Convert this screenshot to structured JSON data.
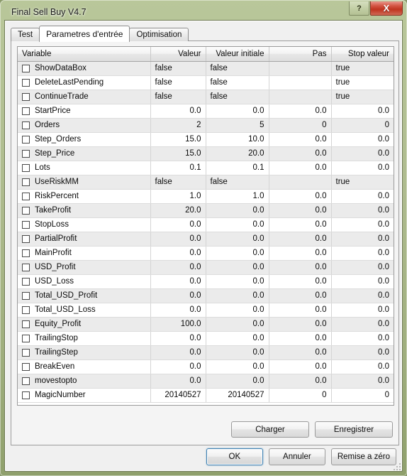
{
  "window": {
    "title": "Final Sell Buy V4.7",
    "help_label": "?",
    "close_label": "X",
    "frame_color": "#aebb8e",
    "close_color": "#c6402c"
  },
  "tabs": [
    {
      "label": "Test",
      "active": false
    },
    {
      "label": "Parametres d'entrée",
      "active": true
    },
    {
      "label": "Optimisation",
      "active": false
    }
  ],
  "table": {
    "columns": [
      {
        "key": "variable",
        "label": "Variable",
        "align": "left"
      },
      {
        "key": "value",
        "label": "Valeur",
        "align": "right"
      },
      {
        "key": "initial",
        "label": "Valeur initiale",
        "align": "right"
      },
      {
        "key": "step",
        "label": "Pas",
        "align": "right"
      },
      {
        "key": "stop",
        "label": "Stop valeur",
        "align": "right"
      }
    ],
    "rows": [
      {
        "variable": "ShowDataBox",
        "value": "false",
        "initial": "false",
        "step": "",
        "stop": "true",
        "type": "bool",
        "checked": false
      },
      {
        "variable": "DeleteLastPending",
        "value": "false",
        "initial": "false",
        "step": "",
        "stop": "true",
        "type": "bool",
        "checked": false
      },
      {
        "variable": "ContinueTrade",
        "value": "false",
        "initial": "false",
        "step": "",
        "stop": "true",
        "type": "bool",
        "checked": false
      },
      {
        "variable": "StartPrice",
        "value": "0.0",
        "initial": "0.0",
        "step": "0.0",
        "stop": "0.0",
        "type": "numeric",
        "checked": false
      },
      {
        "variable": "Orders",
        "value": "2",
        "initial": "5",
        "step": "0",
        "stop": "0",
        "type": "numeric",
        "checked": false
      },
      {
        "variable": "Step_Orders",
        "value": "15.0",
        "initial": "10.0",
        "step": "0.0",
        "stop": "0.0",
        "type": "numeric",
        "checked": false
      },
      {
        "variable": "Step_Price",
        "value": "15.0",
        "initial": "20.0",
        "step": "0.0",
        "stop": "0.0",
        "type": "numeric",
        "checked": false
      },
      {
        "variable": "Lots",
        "value": "0.1",
        "initial": "0.1",
        "step": "0.0",
        "stop": "0.0",
        "type": "numeric",
        "checked": false
      },
      {
        "variable": "UseRiskMM",
        "value": "false",
        "initial": "false",
        "step": "",
        "stop": "true",
        "type": "bool",
        "checked": false
      },
      {
        "variable": "RiskPercent",
        "value": "1.0",
        "initial": "1.0",
        "step": "0.0",
        "stop": "0.0",
        "type": "numeric",
        "checked": false
      },
      {
        "variable": "TakeProfit",
        "value": "20.0",
        "initial": "0.0",
        "step": "0.0",
        "stop": "0.0",
        "type": "numeric",
        "checked": false
      },
      {
        "variable": "StopLoss",
        "value": "0.0",
        "initial": "0.0",
        "step": "0.0",
        "stop": "0.0",
        "type": "numeric",
        "checked": false
      },
      {
        "variable": "PartialProfit",
        "value": "0.0",
        "initial": "0.0",
        "step": "0.0",
        "stop": "0.0",
        "type": "numeric",
        "checked": false
      },
      {
        "variable": "MainProfit",
        "value": "0.0",
        "initial": "0.0",
        "step": "0.0",
        "stop": "0.0",
        "type": "numeric",
        "checked": false
      },
      {
        "variable": "USD_Profit",
        "value": "0.0",
        "initial": "0.0",
        "step": "0.0",
        "stop": "0.0",
        "type": "numeric",
        "checked": false
      },
      {
        "variable": "USD_Loss",
        "value": "0.0",
        "initial": "0.0",
        "step": "0.0",
        "stop": "0.0",
        "type": "numeric",
        "checked": false
      },
      {
        "variable": "Total_USD_Profit",
        "value": "0.0",
        "initial": "0.0",
        "step": "0.0",
        "stop": "0.0",
        "type": "numeric",
        "checked": false
      },
      {
        "variable": "Total_USD_Loss",
        "value": "0.0",
        "initial": "0.0",
        "step": "0.0",
        "stop": "0.0",
        "type": "numeric",
        "checked": false
      },
      {
        "variable": "Equity_Profit",
        "value": "100.0",
        "initial": "0.0",
        "step": "0.0",
        "stop": "0.0",
        "type": "numeric",
        "checked": false
      },
      {
        "variable": "TrailingStop",
        "value": "0.0",
        "initial": "0.0",
        "step": "0.0",
        "stop": "0.0",
        "type": "numeric",
        "checked": false
      },
      {
        "variable": "TrailingStep",
        "value": "0.0",
        "initial": "0.0",
        "step": "0.0",
        "stop": "0.0",
        "type": "numeric",
        "checked": false
      },
      {
        "variable": "BreakEven",
        "value": "0.0",
        "initial": "0.0",
        "step": "0.0",
        "stop": "0.0",
        "type": "numeric",
        "checked": false
      },
      {
        "variable": "movestopto",
        "value": "0.0",
        "initial": "0.0",
        "step": "0.0",
        "stop": "0.0",
        "type": "numeric",
        "checked": false
      },
      {
        "variable": "MagicNumber",
        "value": "20140527",
        "initial": "20140527",
        "step": "0",
        "stop": "0",
        "type": "numeric",
        "checked": false
      }
    ]
  },
  "file_buttons": {
    "charger_label": "Charger",
    "enregistrer_label": "Enregistrer"
  },
  "dialog_buttons": {
    "ok_label": "OK",
    "cancel_label": "Annuler",
    "reset_label": "Remise a zéro"
  }
}
